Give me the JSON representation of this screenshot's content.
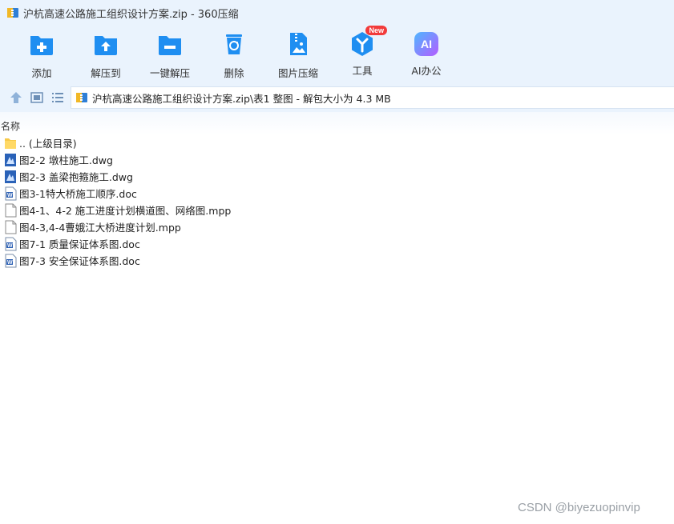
{
  "window": {
    "title": "沪杭高速公路施工组织设计方案.zip - 360压缩"
  },
  "toolbar": {
    "items": [
      {
        "label": "添加",
        "icon": "add-folder-icon"
      },
      {
        "label": "解压到",
        "icon": "extract-to-icon"
      },
      {
        "label": "一键解压",
        "icon": "one-click-extract-icon"
      },
      {
        "label": "删除",
        "icon": "recycle-bin-icon"
      },
      {
        "label": "图片压缩",
        "icon": "image-compress-icon"
      },
      {
        "label": "工具",
        "icon": "tools-icon",
        "badge": "New"
      },
      {
        "label": "AI办公",
        "icon": "ai-office-icon",
        "icon_text": "AI"
      }
    ]
  },
  "navigation": {
    "path": "沪杭高速公路施工组织设计方案.zip\\表1 整图 - 解包大小为 4.3 MB",
    "buttons": [
      "up-arrow-icon",
      "view-thumbnail-icon",
      "view-list-icon"
    ]
  },
  "file_list": {
    "column_header": "名称",
    "items": [
      {
        "name": ".. (上级目录)",
        "type": "folder"
      },
      {
        "name": "图2-2 墩柱施工.dwg",
        "type": "dwg"
      },
      {
        "name": "图2-3 盖梁抱箍施工.dwg",
        "type": "dwg"
      },
      {
        "name": "图3-1特大桥施工顺序.doc",
        "type": "doc"
      },
      {
        "name": "图4-1、4-2  施工进度计划横道图、网络图.mpp",
        "type": "mpp"
      },
      {
        "name": "图4-3,4-4曹娥江大桥进度计划.mpp",
        "type": "mpp"
      },
      {
        "name": "图7-1 质量保证体系图.doc",
        "type": "doc"
      },
      {
        "name": "图7-3 安全保证体系图.doc",
        "type": "doc"
      }
    ]
  },
  "watermark": "CSDN @biyezuopinvip",
  "colors": {
    "accent": "#1f8ef1",
    "toolbar_bg": "#eaf3fd",
    "badge": "#f23b3b"
  }
}
